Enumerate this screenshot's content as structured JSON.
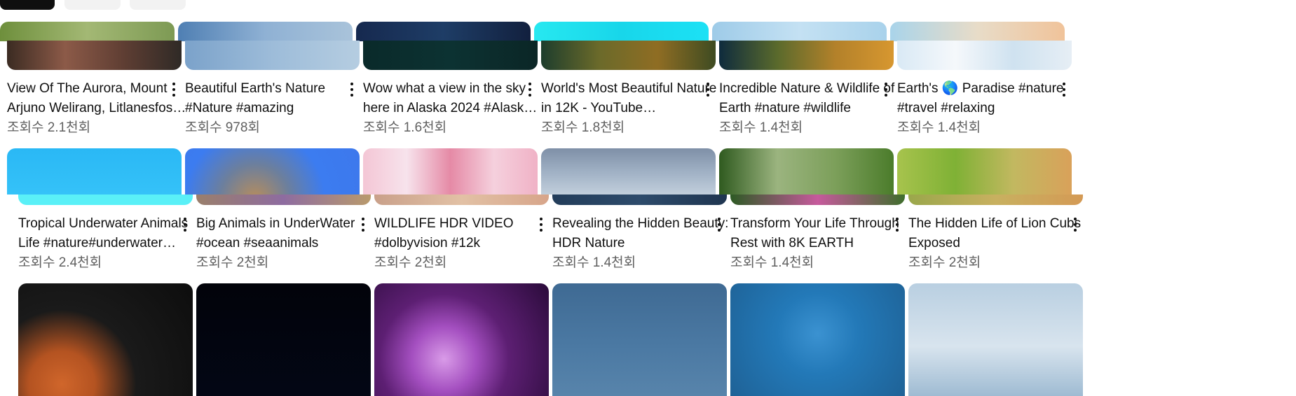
{
  "chips": [
    {
      "label": "",
      "active": true
    },
    {
      "label": "",
      "active": false
    },
    {
      "label": "",
      "active": false
    }
  ],
  "rows": [
    {
      "videos": [
        {
          "title": "View Of The Aurora, Mount Arjuno Welirang, Litlanesfos…",
          "views": "조회수 2.1천회"
        },
        {
          "title": "Beautiful Earth's Nature #Nature #amazing",
          "views": "조회수 978회"
        },
        {
          "title": "Wow what a view in the sky here in Alaska 2024 #Alask…",
          "views": "조회수 1.6천회"
        },
        {
          "title": "World's Most Beautiful Nature in 12K - YouTube…",
          "views": "조회수 1.8천회"
        },
        {
          "title": "Incredible Nature & Wildlife of Earth #nature #wildlife",
          "views": "조회수 1.4천회"
        },
        {
          "title": "Earth's 🌎 Paradise #nature #travel #relaxing",
          "views": "조회수 1.4천회"
        }
      ]
    },
    {
      "videos": [
        {
          "title": "Tropical Underwater Animals Life #nature#underwater…",
          "views": "조회수 2.4천회"
        },
        {
          "title": "Big Animals in UnderWater #ocean #seaanimals",
          "views": "조회수 2천회"
        },
        {
          "title": "WILDLIFE HDR VIDEO #dolbyvision #12k",
          "views": "조회수 2천회"
        },
        {
          "title": "Revealing the Hidden Beauty: HDR Nature",
          "views": "조회수 1.4천회"
        },
        {
          "title": "Transform Your Life Through Rest with 8K EARTH",
          "views": "조회수 1.4천회"
        },
        {
          "title": "The Hidden Life of Lion Cubs Exposed",
          "views": "조회수 2천회"
        }
      ]
    }
  ],
  "colors": {
    "title": "#0f0f0f",
    "meta": "#606060",
    "chip_active": "#0f0f0f",
    "chip": "#f2f2f2"
  }
}
